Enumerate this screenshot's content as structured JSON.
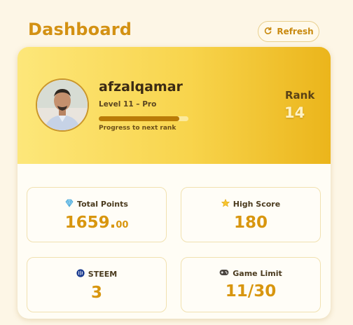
{
  "header": {
    "title": "Dashboard",
    "refresh_label": "Refresh",
    "refresh_icon": "refresh-icon"
  },
  "profile": {
    "username": "afzalqamar",
    "level": "Level 11 – Pro",
    "progress_fraction": 0.9,
    "progress_label": "Progress to next rank",
    "rank_label": "Rank",
    "rank_value": "14"
  },
  "stats": {
    "total_points": {
      "icon": "diamond-icon",
      "label": "Total Points",
      "value_int": "1659.",
      "value_dec": "00"
    },
    "high_score": {
      "icon": "star-icon",
      "label": "High Score",
      "value": "180"
    },
    "steem": {
      "icon": "steem-icon",
      "label": "STEEM",
      "value": "3"
    },
    "game_limit": {
      "icon": "gamepad-icon",
      "label": "Game Limit",
      "value": "11/30"
    }
  },
  "colors": {
    "accent": "#d8960f",
    "background": "#fdf6e6",
    "hero_start": "#fde77a",
    "hero_end": "#ebb51b"
  }
}
